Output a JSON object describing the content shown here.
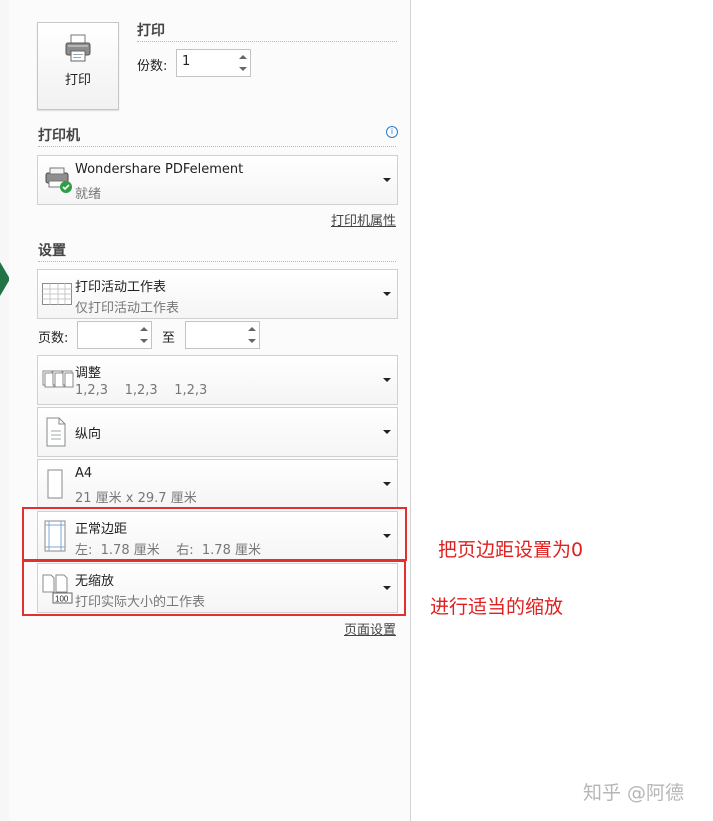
{
  "print": {
    "button_label": "打印",
    "section_title": "打印",
    "copies_label": "份数:",
    "copies_value": "1"
  },
  "printer": {
    "section_title": "打印机",
    "name": "Wondershare PDFelement",
    "status": "就绪",
    "properties_link": "打印机属性"
  },
  "settings": {
    "section_title": "设置",
    "scope": {
      "main": "打印活动工作表",
      "sub": "仅打印活动工作表"
    },
    "pages_label": "页数:",
    "pages_to_label": "至",
    "pages_from_value": "",
    "pages_to_value": "",
    "collate": {
      "main": "调整",
      "sub": "1,2,3    1,2,3    1,2,3"
    },
    "orientation": {
      "main": "纵向"
    },
    "paper": {
      "main": "A4",
      "sub": "21 厘米 x 29.7 厘米"
    },
    "margins": {
      "main": "正常边距",
      "sub": "左:  1.78 厘米    右:  1.78 厘米"
    },
    "scaling": {
      "main": "无缩放",
      "sub": "打印实际大小的工作表"
    },
    "page_setup_link": "页面设置"
  },
  "annotations": {
    "margin_note": "把页边距设置为0",
    "scale_note": "进行适当的缩放",
    "color": "#e02020"
  },
  "watermark": "知乎 @阿德",
  "colors": {
    "accent": "#217346",
    "panel": "#fbfbfb",
    "info": "#2b7bd6"
  },
  "icons": [
    "printer-icon",
    "printer-ready-icon",
    "info-icon",
    "worksheet-icon",
    "collate-icon",
    "portrait-icon",
    "paper-icon",
    "margins-icon",
    "scaling-icon"
  ]
}
